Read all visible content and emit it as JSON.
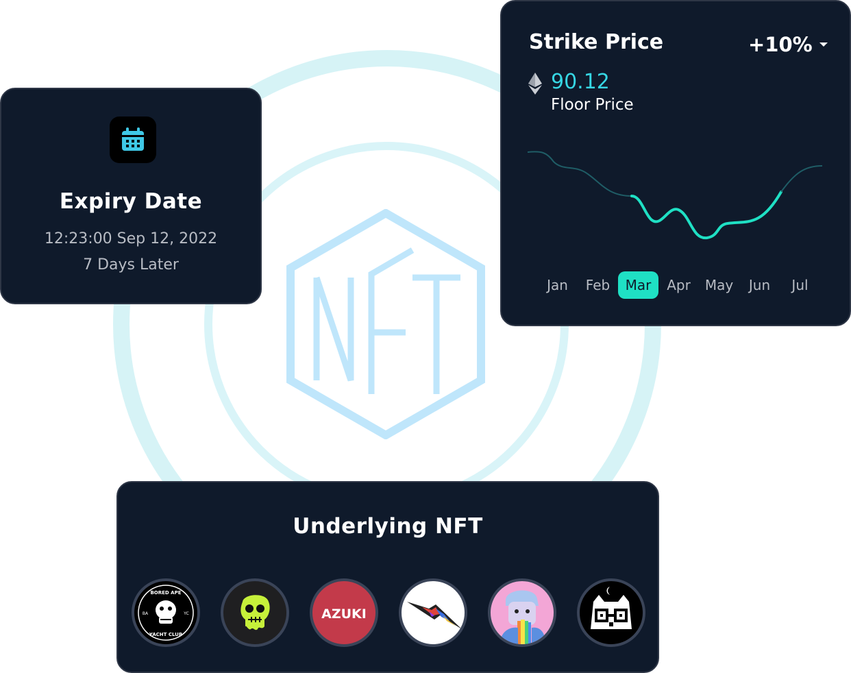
{
  "expiry": {
    "title": "Expiry Date",
    "datetime": "12:23:00 Sep 12, 2022",
    "relative": "7 Days Later",
    "icon": "calendar-icon"
  },
  "strike": {
    "title": "Strike Price",
    "percent": "+10%",
    "floor_value": "90.12",
    "floor_label": "Floor Price",
    "currency_icon": "ethereum-icon",
    "months": [
      "Jan",
      "Feb",
      "Mar",
      "Apr",
      "May",
      "Jun",
      "Jul"
    ],
    "selected_month": "Mar",
    "accent": "#1fe0c4"
  },
  "underlying": {
    "title": "Underlying NFT",
    "collections": [
      {
        "name": "bored-ape-yacht-club",
        "logo_text_top": "BORED APE",
        "logo_text_bottom": "YACHT CLUB",
        "logo_left": "BA",
        "logo_right": "YC"
      },
      {
        "name": "mutant-ape"
      },
      {
        "name": "azuki",
        "logo_text": "AZUKI"
      },
      {
        "name": "graffiti-nft"
      },
      {
        "name": "rainbow-punk"
      },
      {
        "name": "pixel-owl"
      }
    ]
  },
  "logo": {
    "text": "NFT"
  }
}
